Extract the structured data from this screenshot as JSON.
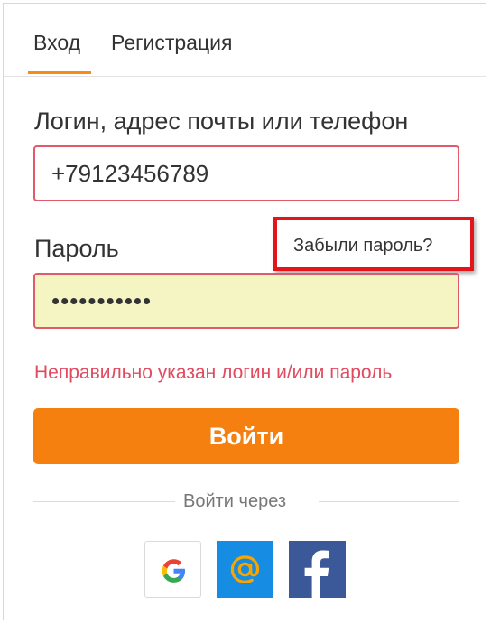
{
  "tabs": {
    "login": "Вход",
    "register": "Регистрация"
  },
  "form": {
    "login_label": "Логин, адрес почты или телефон",
    "login_value": "+79123456789",
    "password_label": "Пароль",
    "password_value": "•••••••••••",
    "forgot_link": "Забыли пароль?",
    "error_message": "Неправильно указан логин и/или пароль",
    "submit_label": "Войти"
  },
  "social": {
    "divider_text": "Войти через",
    "providers": [
      {
        "name": "Google",
        "icon": "google-icon"
      },
      {
        "name": "Mail.ru",
        "icon": "mail-at-icon"
      },
      {
        "name": "Facebook",
        "icon": "facebook-icon"
      }
    ]
  },
  "colors": {
    "accent": "#f6800f",
    "tab_underline": "#f68d16",
    "error": "#e04b5f",
    "input_error_border": "#e05a6a",
    "highlight_box": "#e4141b",
    "password_fill": "#f5f5c4",
    "mail_blue": "#168de2",
    "facebook_blue": "#3b5998"
  }
}
